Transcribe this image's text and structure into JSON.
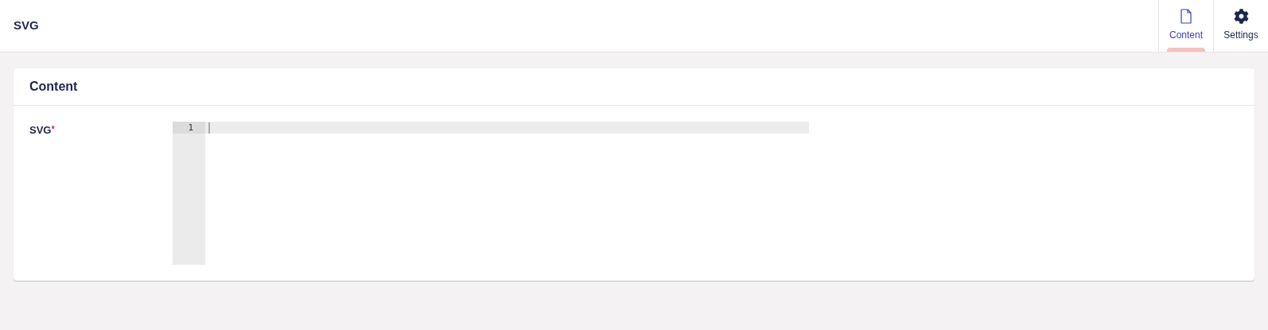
{
  "header": {
    "title": "SVG"
  },
  "tabs": [
    {
      "label": "Content",
      "kind": "document",
      "selected": true
    },
    {
      "label": "Settings",
      "kind": "gear",
      "selected": false
    }
  ],
  "panel": {
    "title": "Content",
    "fields": [
      {
        "label": "SVG",
        "required_marker": "*",
        "editor": {
          "line_numbers": [
            "1"
          ]
        }
      }
    ]
  }
}
